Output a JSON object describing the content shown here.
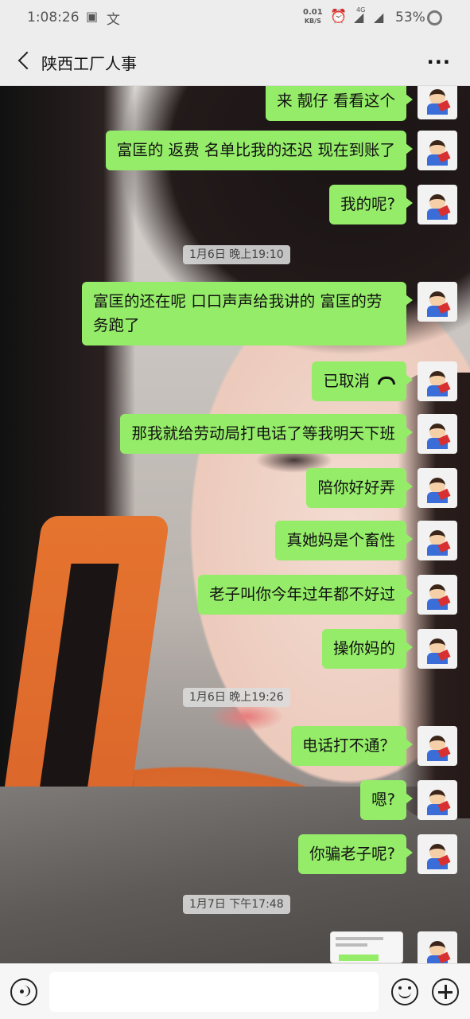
{
  "status_bar": {
    "time": "1:08:26",
    "speed_value": "0.01",
    "speed_unit": "KB/S",
    "network": "4G",
    "battery": "53%"
  },
  "header": {
    "title": "陕西工厂人事",
    "back_icon": "back-arrow",
    "more_icon": "more-dots"
  },
  "messages": [
    {
      "type": "text",
      "sender": "me",
      "text": "来 靓仔 看看这个"
    },
    {
      "type": "text",
      "sender": "me",
      "text": "富匡的 返费 名单比我的还迟 现在到账了"
    },
    {
      "type": "text",
      "sender": "me",
      "text": "我的呢?"
    },
    {
      "type": "time",
      "text": "1月6日 晚上19:10"
    },
    {
      "type": "text",
      "sender": "me",
      "text": "富匡的还在呢 口口声声给我讲的 富匡的劳务跑了"
    },
    {
      "type": "call",
      "sender": "me",
      "text": "已取消"
    },
    {
      "type": "text",
      "sender": "me",
      "text": "那我就给劳动局打电话了等我明天下班"
    },
    {
      "type": "text",
      "sender": "me",
      "text": "陪你好好弄"
    },
    {
      "type": "text",
      "sender": "me",
      "text": "真她妈是个畜性"
    },
    {
      "type": "text",
      "sender": "me",
      "text": "老子叫你今年过年都不好过"
    },
    {
      "type": "text",
      "sender": "me",
      "text": "操你妈的"
    },
    {
      "type": "time",
      "text": "1月6日 晚上19:26"
    },
    {
      "type": "text",
      "sender": "me",
      "text": "电话打不通？"
    },
    {
      "type": "text",
      "sender": "me",
      "text": "嗯?"
    },
    {
      "type": "text",
      "sender": "me",
      "text": "你骗老子呢?"
    },
    {
      "type": "time",
      "text": "1月7日 下午17:48"
    },
    {
      "type": "image",
      "sender": "me"
    }
  ],
  "input_bar": {
    "voice_icon": "voice-icon",
    "emoji_icon": "emoji-icon",
    "plus_icon": "plus-icon"
  }
}
